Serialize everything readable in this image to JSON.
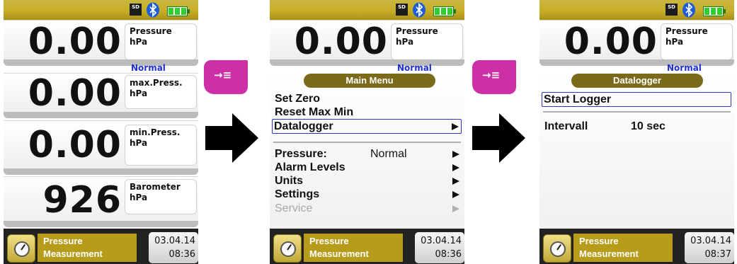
{
  "status": {
    "sd_label": "SD",
    "bluetooth": "bluetooth-icon",
    "battery": "battery-full-icon"
  },
  "screen1": {
    "panels": [
      {
        "value": "0.00",
        "label": "Pressure",
        "unit": "hPa",
        "mode": "Normal"
      },
      {
        "value": "0.00",
        "label": "max.Press.",
        "unit": "hPa"
      },
      {
        "value": "0.00",
        "label": "min.Press.",
        "unit": "hPa"
      },
      {
        "value": "926",
        "label": "Barometer",
        "unit": "hPa"
      }
    ],
    "footer": {
      "title_line1": "Pressure",
      "title_line2": "Measurement",
      "date": "03.04.14",
      "time": "08:36"
    }
  },
  "screen2": {
    "top": {
      "value": "0.00",
      "label": "Pressure",
      "unit": "hPa",
      "mode": "Normal"
    },
    "menu_title": "Main Menu",
    "items_group1": [
      {
        "label": "Set Zero"
      },
      {
        "label": "Reset Max Min"
      },
      {
        "label": "Datalogger",
        "selected": true
      }
    ],
    "items_group2": [
      {
        "label": "Pressure:",
        "value": "Normal"
      },
      {
        "label": "Alarm Levels"
      },
      {
        "label": "Units"
      },
      {
        "label": "Settings"
      },
      {
        "label": "Service",
        "disabled": true
      }
    ],
    "footer": {
      "title_line1": "Pressure",
      "title_line2": "Measurement",
      "date": "03.04.14",
      "time": "08:36"
    }
  },
  "screen3": {
    "top": {
      "value": "0.00",
      "label": "Pressure",
      "unit": "hPa",
      "mode": "Normal"
    },
    "menu_title": "Datalogger",
    "start_label": "Start Logger",
    "interval_label": "Intervall",
    "interval_value": "10 sec",
    "footer": {
      "title_line1": "Pressure",
      "title_line2": "Measurement",
      "date": "03.04.14",
      "time": "08:37"
    }
  },
  "softkey_symbol": "→≡",
  "colors": {
    "statusbar": "#c7ae28",
    "accent_blue": "#1f2fd8",
    "softkey": "#cc2fa6",
    "menu_title_bg": "#7b6a1a"
  }
}
